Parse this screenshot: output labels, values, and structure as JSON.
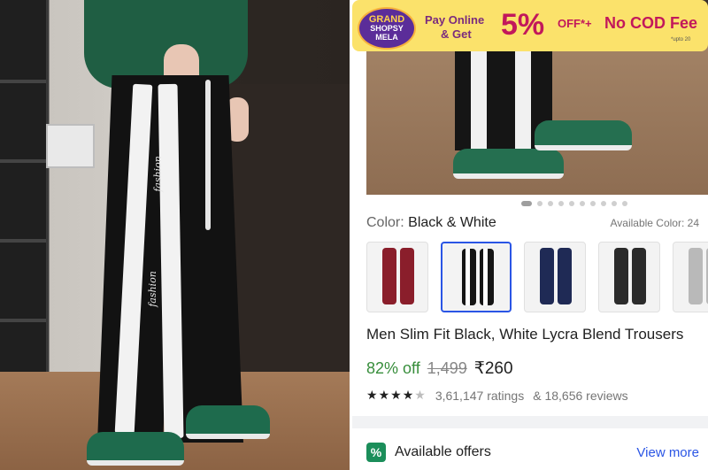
{
  "banner": {
    "badge_line1": "GRAND",
    "badge_line2": "SHOPSY",
    "badge_line3": "MELA",
    "pay_line1": "Pay Online",
    "pay_line2": "& Get",
    "percent": "5%",
    "off_text": "OFF*+",
    "no_cod": "No COD Fee",
    "upto": "*upto 20"
  },
  "carousel": {
    "total_dots": 10,
    "active_index": 0
  },
  "color": {
    "label": "Color:",
    "value": "Black & White",
    "available": "Available Color: 24"
  },
  "swatches": [
    {
      "name": "Maroon",
      "color": "#8a1e2b",
      "selected": false
    },
    {
      "name": "Black & White",
      "color": "#151515",
      "selected": true
    },
    {
      "name": "Navy",
      "color": "#1f2a55",
      "selected": false
    },
    {
      "name": "Black/Grey",
      "color": "#2b2b2b",
      "selected": false
    },
    {
      "name": "Grey",
      "color": "#b9b9b9",
      "selected": false
    }
  ],
  "product": {
    "title": "Men Slim Fit Black, White Lycra Blend Trousers",
    "discount": "82% off",
    "mrp": "1,499",
    "price": "₹260",
    "rating_value": 4,
    "ratings_text": "3,61,147 ratings",
    "reviews_text": "& 18,656 reviews"
  },
  "offers": {
    "title": "Available offers",
    "view_more": "View more"
  },
  "hero": {
    "print_text": "fashion"
  },
  "colors": {
    "accent_blue": "#2a55e5",
    "discount_green": "#388e3c",
    "banner_yellow": "#fbe26b",
    "banner_magenta": "#c2185b"
  }
}
